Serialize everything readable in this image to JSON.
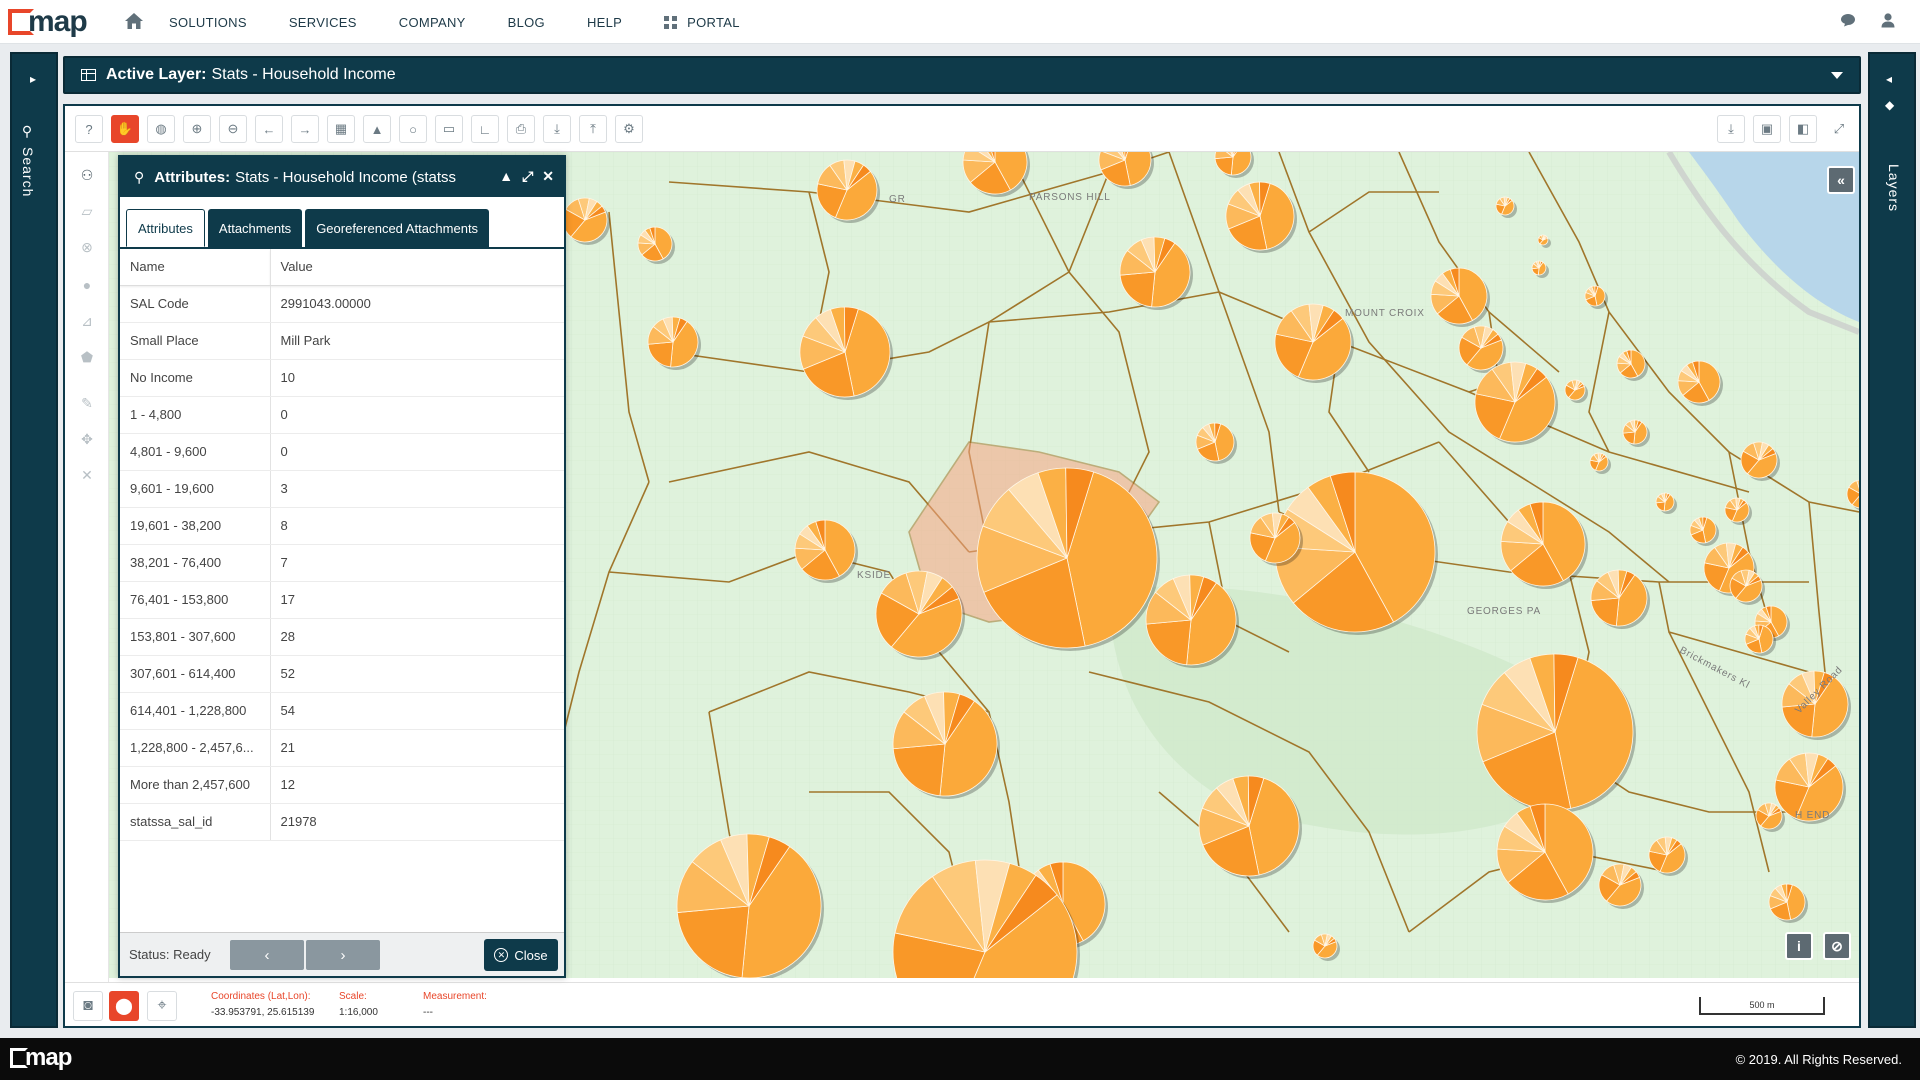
{
  "nav": {
    "brand": "map",
    "items": [
      "SOLUTIONS",
      "SERVICES",
      "COMPANY",
      "BLOG",
      "HELP"
    ],
    "portal": "PORTAL"
  },
  "rails": {
    "left_label": "Search",
    "right_label": "Layers"
  },
  "layer_bar": {
    "prefix": "Active Layer:",
    "name": "Stats - Household Income"
  },
  "attributes_panel": {
    "title_prefix": "Attributes:",
    "title": "Stats - Household Income (statss",
    "tabs": [
      "Attributes",
      "Attachments",
      "Georeferenced Attachments"
    ],
    "columns": [
      "Name",
      "Value"
    ],
    "rows": [
      [
        "SAL Code",
        "2991043.00000"
      ],
      [
        "Small Place",
        "Mill Park"
      ],
      [
        "No Income",
        "10"
      ],
      [
        "1 - 4,800",
        "0"
      ],
      [
        "4,801 - 9,600",
        "0"
      ],
      [
        "9,601 - 19,600",
        "3"
      ],
      [
        "19,601 - 38,200",
        "8"
      ],
      [
        "38,201 - 76,400",
        "7"
      ],
      [
        "76,401 - 153,800",
        "17"
      ],
      [
        "153,801 - 307,600",
        "28"
      ],
      [
        "307,601 - 614,400",
        "52"
      ],
      [
        "614,401 - 1,228,800",
        "54"
      ],
      [
        "1,228,800 - 2,457,6...",
        "21"
      ],
      [
        "More than 2,457,600",
        "12"
      ],
      [
        "statssa_sal_id",
        "21978"
      ]
    ],
    "status": "Status: Ready",
    "close_label": "Close"
  },
  "map_labels": [
    "PARSONS HILL",
    "MOUNT CROIX",
    "GEORGES PA",
    "KSIDE",
    "GR",
    "H END",
    "Valley Road",
    "Brickmakers Kl"
  ],
  "bottom_bar": {
    "coord_label": "Coordinates (Lat,Lon):",
    "coord_value": "-33.953791, 25.615139",
    "scale_label": "Scale:",
    "scale_value": "1:16,000",
    "measure_label": "Measurement:",
    "measure_value": "---",
    "scalebar": "500 m"
  },
  "footer": {
    "brand": "map",
    "copyright": "© 2019. All Rights Reserved."
  },
  "colors": {
    "accent": "#e8462a",
    "navy": "#0e3a4a",
    "map_bg": "#dff2dc",
    "pie": "#fbb040"
  }
}
